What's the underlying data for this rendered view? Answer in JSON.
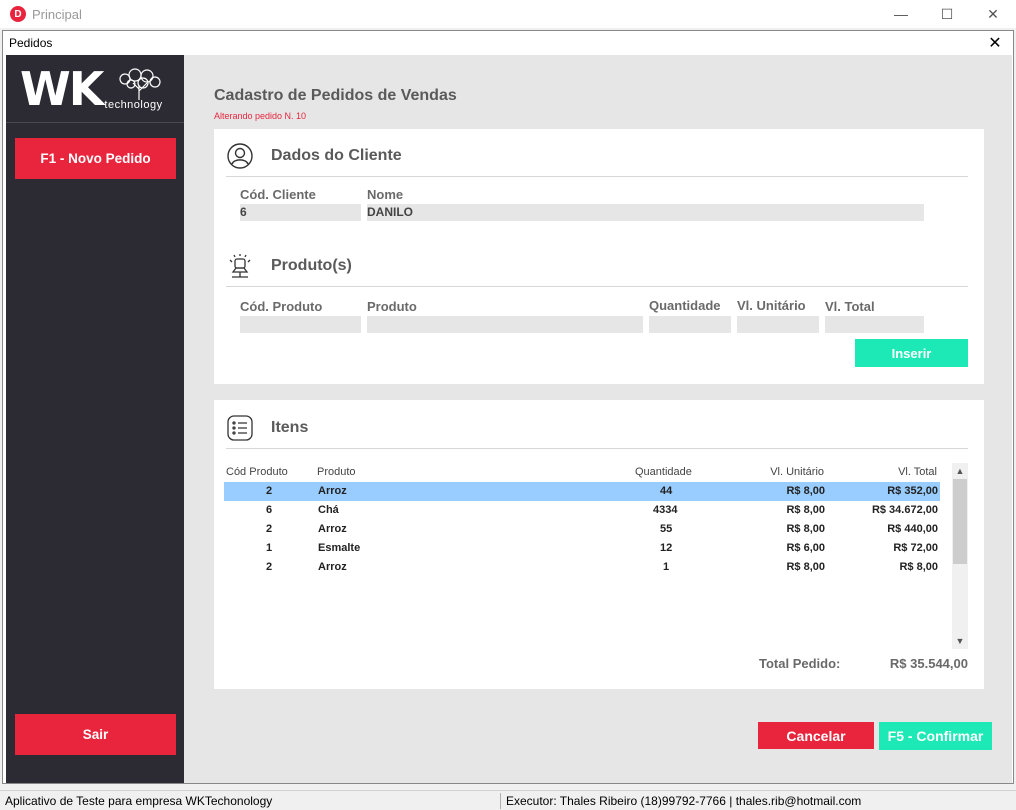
{
  "outer_window": {
    "title": "Principal",
    "logo_letter": "D"
  },
  "inner_window": {
    "title": "Pedidos"
  },
  "sidebar": {
    "brand": {
      "wk": "WK",
      "sub": "technology"
    },
    "new_order_label": "F1 - Novo Pedido",
    "exit_label": "Sair"
  },
  "main": {
    "title": "Cadastro de Pedidos de Vendas",
    "subtitle": "Alterando pedido N. 10"
  },
  "client": {
    "section_title": "Dados do Cliente",
    "code_label": "Cód. Cliente",
    "code_value": "6",
    "name_label": "Nome",
    "name_value": "DANILO"
  },
  "product": {
    "section_title": "Produto(s)",
    "code_label": "Cód. Produto",
    "product_label": "Produto",
    "quantity_label": "Quantidade",
    "unit_label": "Vl. Unitário",
    "total_label": "Vl. Total",
    "insert_label": "Inserir"
  },
  "items": {
    "section_title": "Itens",
    "columns": [
      "Cód Produto",
      "Produto",
      "Quantidade",
      "Vl. Unitário",
      "Vl. Total"
    ],
    "rows": [
      {
        "code": "2",
        "product": "Arroz",
        "qty": "44",
        "unit": "R$ 8,00",
        "total": "R$ 352,00"
      },
      {
        "code": "6",
        "product": "Chá",
        "qty": "4334",
        "unit": "R$ 8,00",
        "total": "R$ 34.672,00"
      },
      {
        "code": "2",
        "product": "Arroz",
        "qty": "55",
        "unit": "R$ 8,00",
        "total": "R$ 440,00"
      },
      {
        "code": "1",
        "product": "Esmalte",
        "qty": "12",
        "unit": "R$ 6,00",
        "total": "R$ 72,00"
      },
      {
        "code": "2",
        "product": "Arroz",
        "qty": "1",
        "unit": "R$ 8,00",
        "total": "R$ 8,00"
      }
    ],
    "selected_row": 0,
    "total_label": "Total Pedido:",
    "total_value": "R$ 35.544,00"
  },
  "actions": {
    "cancel_label": "Cancelar",
    "confirm_label": "F5 -  Confirmar"
  },
  "statusbar": {
    "left": "Aplicativo de Teste para empresa WKTechonology",
    "right": "Executor: Thales Ribeiro (18)99792-7766 | thales.rib@hotmail.com"
  },
  "colors": {
    "accent_red": "#e8253d",
    "accent_green": "#1de9b6",
    "sidebar": "#2c2a33",
    "selection": "#99ccff"
  }
}
